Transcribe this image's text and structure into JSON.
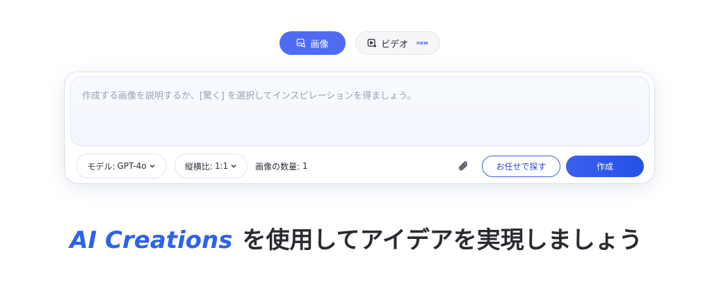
{
  "tabs": [
    {
      "label": "画像",
      "icon": "image-search-icon",
      "active": true
    },
    {
      "label": "ビデオ",
      "icon": "video-play-icon",
      "badge": "new",
      "active": false
    }
  ],
  "prompt": {
    "placeholder": "作成する画像を説明するか、[驚く] を選択してインスピレーションを得ましょう。"
  },
  "toolbar": {
    "model_label": "モデル:",
    "model_value": "GPT-4o",
    "ratio_label": "縦横比:",
    "ratio_value": "1:1",
    "count_label": "画像の数量:",
    "count_value": "1",
    "surprise_label": "お任せで探す",
    "create_label": "作成"
  },
  "headline": {
    "brand": "AI Creations",
    "text": "を使用してアイデアを実現しましょう"
  },
  "colors": {
    "accent": "#4f6bf4",
    "primary_button": "#2b55e8",
    "brand_text": "#2e63e8"
  }
}
